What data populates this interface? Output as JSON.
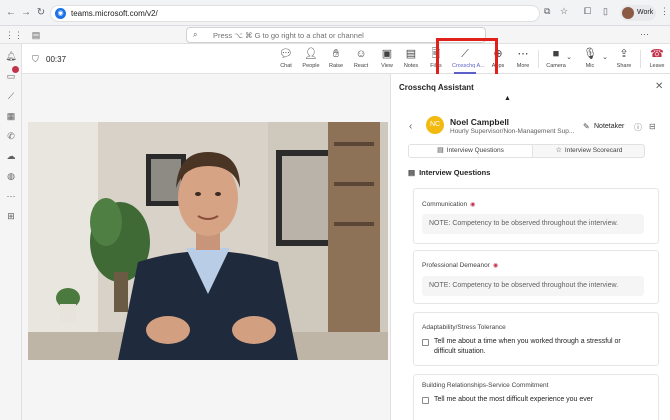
{
  "browser": {
    "url": "teams.microsoft.com/v2/",
    "profile_label": "Work",
    "back_icon": "←",
    "forward_icon": "→",
    "reload_icon": "↻"
  },
  "teams_bar": {
    "search_placeholder": "Press ⌥ ⌘ G to go right to a chat or channel"
  },
  "meeting": {
    "timer": "00:37",
    "toolbar": [
      {
        "label": "Chat",
        "icon": "chat-icon"
      },
      {
        "label": "People",
        "icon": "people-icon"
      },
      {
        "label": "Raise",
        "icon": "raise-hand-icon"
      },
      {
        "label": "React",
        "icon": "react-icon"
      },
      {
        "label": "View",
        "icon": "view-icon"
      },
      {
        "label": "Notes",
        "icon": "notes-icon"
      },
      {
        "label": "Files",
        "icon": "files-icon"
      },
      {
        "label": "Crosschq A...",
        "icon": "crosschq-icon"
      },
      {
        "label": "Apps",
        "icon": "apps-icon"
      },
      {
        "label": "More",
        "icon": "more-icon"
      },
      {
        "label": "Camera",
        "icon": "camera-icon"
      },
      {
        "label": "Mic",
        "icon": "mic-icon"
      },
      {
        "label": "Share",
        "icon": "share-icon"
      },
      {
        "label": "Leave",
        "icon": "leave-icon"
      }
    ],
    "highlight_color": "#e0201b"
  },
  "panel": {
    "title": "Crosschq Assistant",
    "candidate": {
      "initials": "NC",
      "name": "Noel Campbell",
      "role": "Hourly Supervisor/Non-Management Sup..."
    },
    "notetaker_label": "Notetaker",
    "tabs": [
      "Interview Questions",
      "Interview Scorecard"
    ],
    "section_title": "Interview Questions",
    "cards": [
      {
        "label": "Communication",
        "note": "NOTE: Competency to be observed throughout the interview."
      },
      {
        "label": "Professional Demeanor",
        "note": "NOTE: Competency to be observed throughout the interview."
      },
      {
        "label": "Adaptability/Stress Tolerance",
        "question": "Tell me about a time when you worked through a stressful or difficult situation."
      },
      {
        "label": "Building Relationships-Service Commitment",
        "question": "Tell me about the most difficult experience you ever"
      }
    ]
  },
  "colors": {
    "accent": "#5b5fc7",
    "avatar": "#f2b90f",
    "leave": "#c4314b"
  }
}
